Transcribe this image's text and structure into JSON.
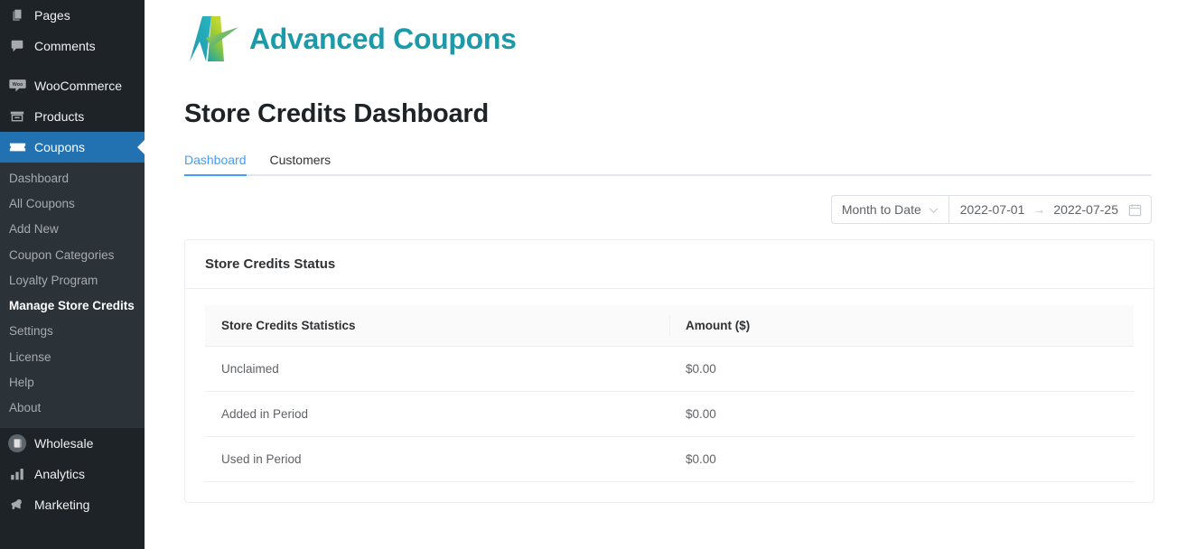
{
  "sidebar": {
    "items": [
      {
        "label": "Pages",
        "icon": "pages-icon",
        "active": false
      },
      {
        "label": "Comments",
        "icon": "comments-icon",
        "active": false
      },
      {
        "label": "WooCommerce",
        "icon": "woocommerce-icon",
        "active": false
      },
      {
        "label": "Products",
        "icon": "products-icon",
        "active": false
      },
      {
        "label": "Coupons",
        "icon": "coupon-ticket-icon",
        "active": true
      },
      {
        "label": "Wholesale",
        "icon": "wholesale-icon",
        "active": false
      },
      {
        "label": "Analytics",
        "icon": "analytics-bar-chart-icon",
        "active": false
      },
      {
        "label": "Marketing",
        "icon": "megaphone-icon",
        "active": false
      }
    ],
    "submenu": [
      {
        "label": "Dashboard",
        "current": false
      },
      {
        "label": "All Coupons",
        "current": false
      },
      {
        "label": "Add New",
        "current": false
      },
      {
        "label": "Coupon Categories",
        "current": false
      },
      {
        "label": "Loyalty Program",
        "current": false
      },
      {
        "label": "Manage Store Credits",
        "current": true
      },
      {
        "label": "Settings",
        "current": false
      },
      {
        "label": "License",
        "current": false
      },
      {
        "label": "Help",
        "current": false
      },
      {
        "label": "About",
        "current": false
      }
    ],
    "colors": {
      "background": "#1d2327",
      "submenu_background": "#2c3338",
      "active_background": "#2271b1",
      "text": "#f0f0f1",
      "submenu_text": "#a7aaad"
    }
  },
  "brand": {
    "logo_text": "Advanced Coupons",
    "logo_color": "#1b9aaa",
    "logo_icon": "advanced-coupons-a-logo"
  },
  "header": {
    "title": "Store Credits Dashboard"
  },
  "tabs": [
    {
      "label": "Dashboard",
      "active": true
    },
    {
      "label": "Customers",
      "active": false
    }
  ],
  "toolbar": {
    "range_preset": "Month to Date",
    "preset_caret_icon": "chevron-down-icon",
    "start_date": "2022-07-01",
    "end_date": "2022-07-25",
    "range_arrow": "→",
    "calendar_icon": "calendar-icon"
  },
  "card": {
    "title": "Store Credits Status",
    "table": {
      "columns": [
        "Store Credits Statistics",
        "Amount ($)"
      ],
      "rows": [
        {
          "statistic": "Unclaimed",
          "amount": "$0.00"
        },
        {
          "statistic": "Added in Period",
          "amount": "$0.00"
        },
        {
          "statistic": "Used in Period",
          "amount": "$0.00"
        }
      ]
    }
  },
  "theme": {
    "accent_blue": "#409eff",
    "wp_blue": "#2271b1",
    "border": "#ebeef5",
    "header_row_bg": "#fafafa"
  }
}
